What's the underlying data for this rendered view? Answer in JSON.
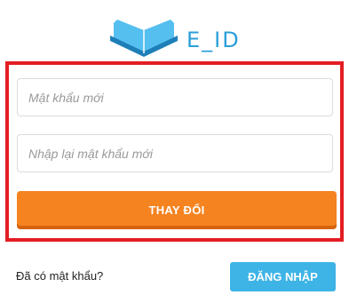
{
  "brand": {
    "name": "E_ID",
    "logo_icon": "open-book-icon",
    "color": "#2a9fd8"
  },
  "form": {
    "new_password_placeholder": "Mật khẩu mới",
    "confirm_password_placeholder": "Nhập lại mật khẩu mới",
    "submit_label": "THAY ĐỔI",
    "highlight_color": "#e31e24",
    "submit_color": "#f58320"
  },
  "footer": {
    "question": "Đã có mật khẩu?",
    "login_label": "ĐĂNG NHẬP",
    "login_color": "#3eb4e6"
  }
}
